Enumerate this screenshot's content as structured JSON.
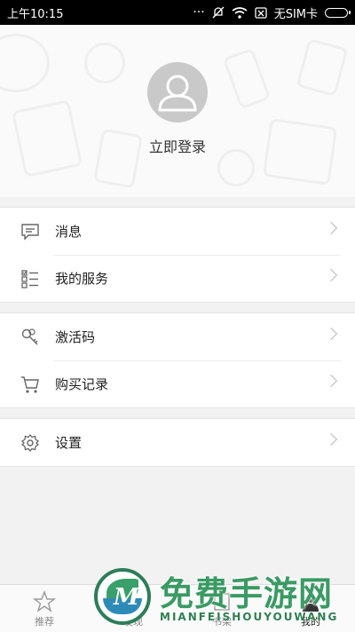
{
  "status_bar": {
    "time": "上午10:15",
    "carrier": "无SIM卡"
  },
  "profile": {
    "login_text": "立即登录"
  },
  "menu_groups": [
    {
      "items": [
        {
          "icon": "message-icon",
          "label": "消息"
        },
        {
          "icon": "service-list-icon",
          "label": "我的服务"
        }
      ]
    },
    {
      "items": [
        {
          "icon": "key-icon",
          "label": "激活码"
        },
        {
          "icon": "cart-icon",
          "label": "购买记录"
        }
      ]
    },
    {
      "items": [
        {
          "icon": "gear-icon",
          "label": "设置"
        }
      ]
    }
  ],
  "tabs": [
    {
      "icon": "star-icon",
      "label": "推荐",
      "active": false
    },
    {
      "icon": "discover-icon",
      "label": "发现",
      "active": false
    },
    {
      "icon": "bookshelf-icon",
      "label": "书架",
      "active": false
    },
    {
      "icon": "user-icon",
      "label": "我的",
      "active": true
    }
  ],
  "watermark": {
    "title": "免费手游网",
    "subtitle": "MIANFEISHOUYOUWANG",
    "logo_letter": "M"
  }
}
